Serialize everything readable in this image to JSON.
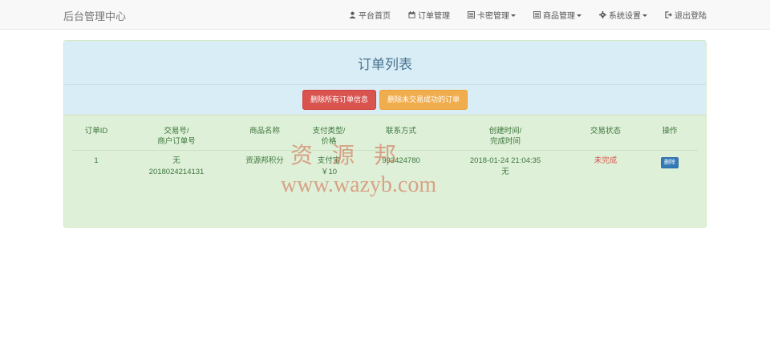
{
  "navbar": {
    "brand": "后台管理中心",
    "items": [
      {
        "label": "平台首页",
        "icon": "user-icon",
        "dropdown": false
      },
      {
        "label": "订单管理",
        "icon": "calendar-icon",
        "dropdown": false
      },
      {
        "label": "卡密管理",
        "icon": "list-icon",
        "dropdown": true
      },
      {
        "label": "商品管理",
        "icon": "list-icon",
        "dropdown": true
      },
      {
        "label": "系统设置",
        "icon": "gear-icon",
        "dropdown": true
      },
      {
        "label": "退出登陆",
        "icon": "logout-icon",
        "dropdown": false
      }
    ]
  },
  "panel": {
    "title": "订单列表",
    "buttons": {
      "delete_all": "删除所有订单信息",
      "delete_unpaid": "删除未交易成功的订单"
    }
  },
  "table": {
    "headers": [
      [
        "订单ID"
      ],
      [
        "交易号/",
        "商户订单号"
      ],
      [
        "商品名称"
      ],
      [
        "支付类型/",
        "价格"
      ],
      [
        "联系方式"
      ],
      [
        "创建时间/",
        "完成时间"
      ],
      [
        "交易状态"
      ],
      [
        "操作"
      ]
    ],
    "rows": [
      {
        "id": "1",
        "trade_no": "无",
        "merchant_no": "2018024214131",
        "product": "资源邦积分",
        "pay_type": "支付宝",
        "price": "￥10",
        "contact": "993424780",
        "created": "2018-01-24 21:04:35",
        "finished": "无",
        "status": "未完成",
        "action": "删除"
      }
    ]
  },
  "watermark": {
    "cn": "资源邦",
    "url": "www.wazyb.com"
  },
  "colors": {
    "danger": "#d9534f",
    "warning": "#f0ad4e",
    "primary": "#337ab7",
    "success_bg": "#dff0d8",
    "info_bg": "#d9edf7"
  }
}
